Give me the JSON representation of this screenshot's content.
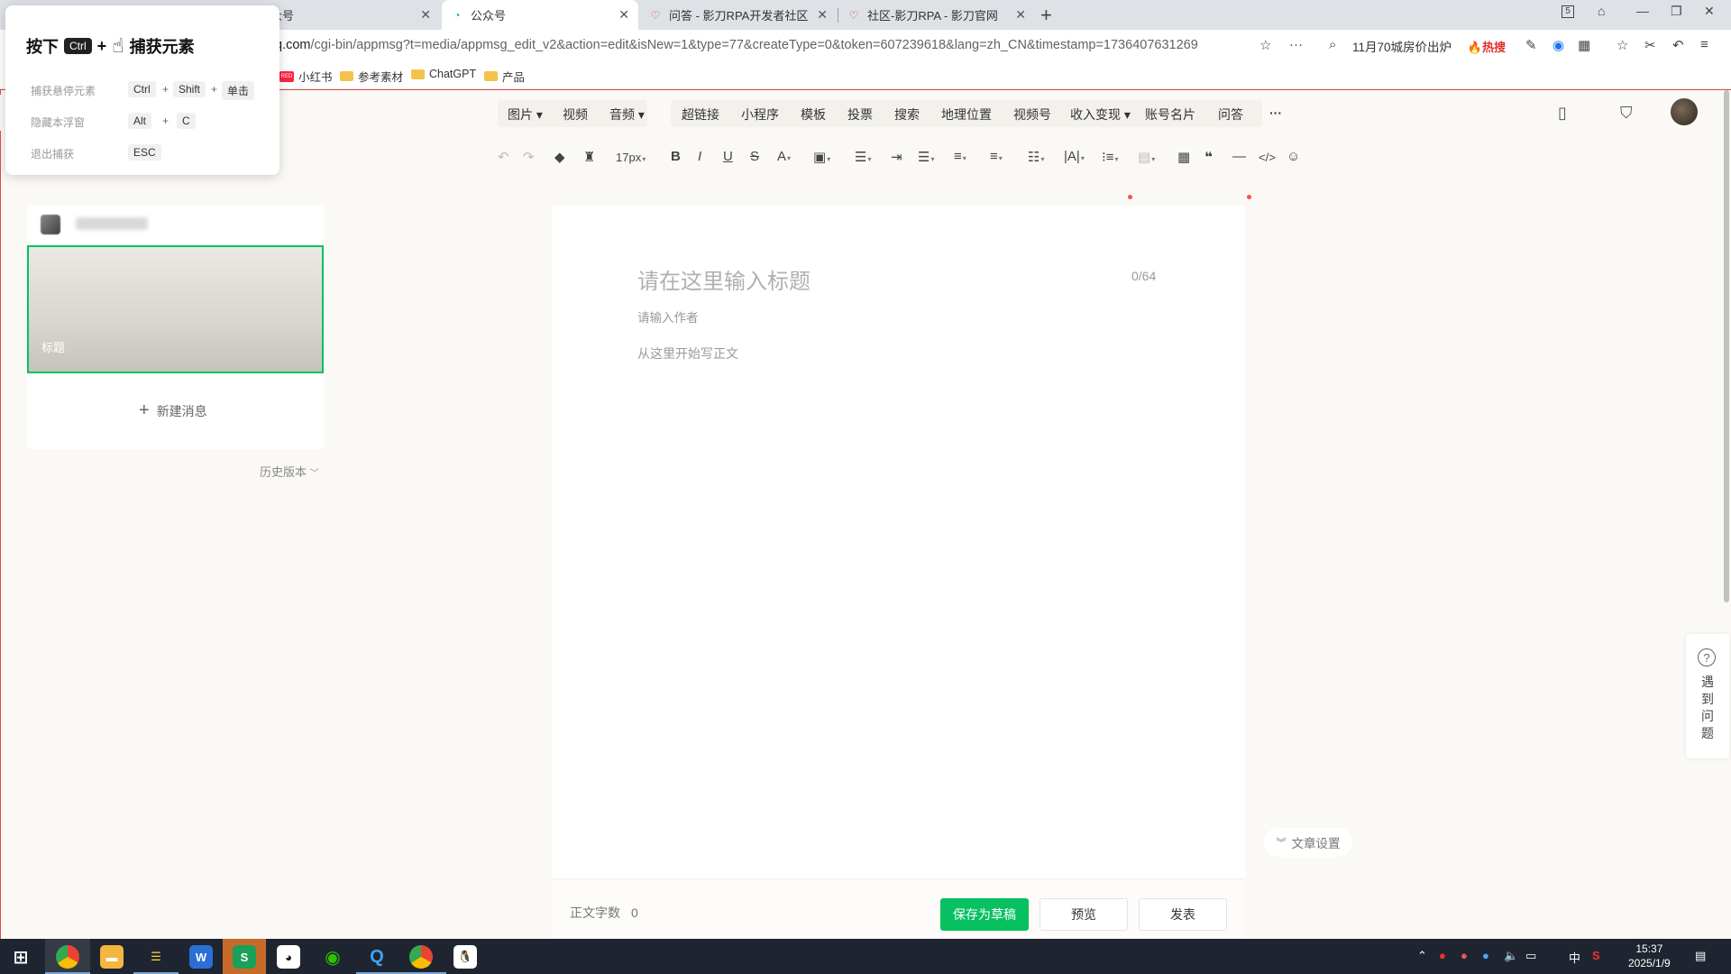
{
  "browser": {
    "tabs": [
      {
        "title": "众号"
      },
      {
        "title": "公众号"
      },
      {
        "title": "问答 - 影刀RPA开发者社区"
      },
      {
        "title": "社区-影刀RPA - 影刀官网"
      }
    ],
    "url_prefix": "q.com",
    "url_rest": "/cgi-bin/appmsg?t=media/appmsg_edit_v2&action=edit&isNew=1&type=77&createType=0&token=607239618&lang=zh_CN&timestamp=1736407631269",
    "search_suggest": "11月70城房价出炉",
    "hot_label": "热搜",
    "tab_count": "5",
    "bookmarks": [
      "小红书",
      "参考素材",
      "ChatGPT",
      "产品"
    ]
  },
  "capture_overlay": {
    "title_prefix": "按下",
    "title_key": "Ctrl",
    "title_plus": "+",
    "title_suffix": "捕获元素",
    "rows": [
      {
        "label": "捕获悬停元素",
        "keys": [
          "Ctrl",
          "Shift",
          "单击"
        ]
      },
      {
        "label": "隐藏本浮窗",
        "keys": [
          "Alt",
          "C"
        ]
      },
      {
        "label": "退出捕获",
        "keys": [
          "ESC"
        ]
      }
    ],
    "plus": "+"
  },
  "toolbar": {
    "insert_items": [
      "图片",
      "视频",
      "音频",
      "超链接",
      "小程序",
      "模板",
      "投票",
      "搜索",
      "地理位置",
      "视频号",
      "收入变现",
      "账号名片",
      "问答"
    ],
    "more": "···",
    "font_size": "17px"
  },
  "left_panel": {
    "cover_label": "标题",
    "new_message": "新建消息",
    "history": "历史版本"
  },
  "editor": {
    "title_placeholder": "请在这里输入标题",
    "title_count": "0/64",
    "author_placeholder": "请输入作者",
    "body_placeholder": "从这里开始写正文",
    "word_count_label": "正文字数",
    "word_count": "0",
    "save_draft": "保存为草稿",
    "preview": "预览",
    "publish": "发表"
  },
  "article_settings": "文章设置",
  "help": "遇到问题",
  "taskbar": {
    "ime": "中",
    "time": "15:37",
    "date": "2025/1/9"
  },
  "colors": {
    "accent": "#07c160",
    "hot": "#e0332b",
    "page_bg": "#fbf9f5"
  }
}
